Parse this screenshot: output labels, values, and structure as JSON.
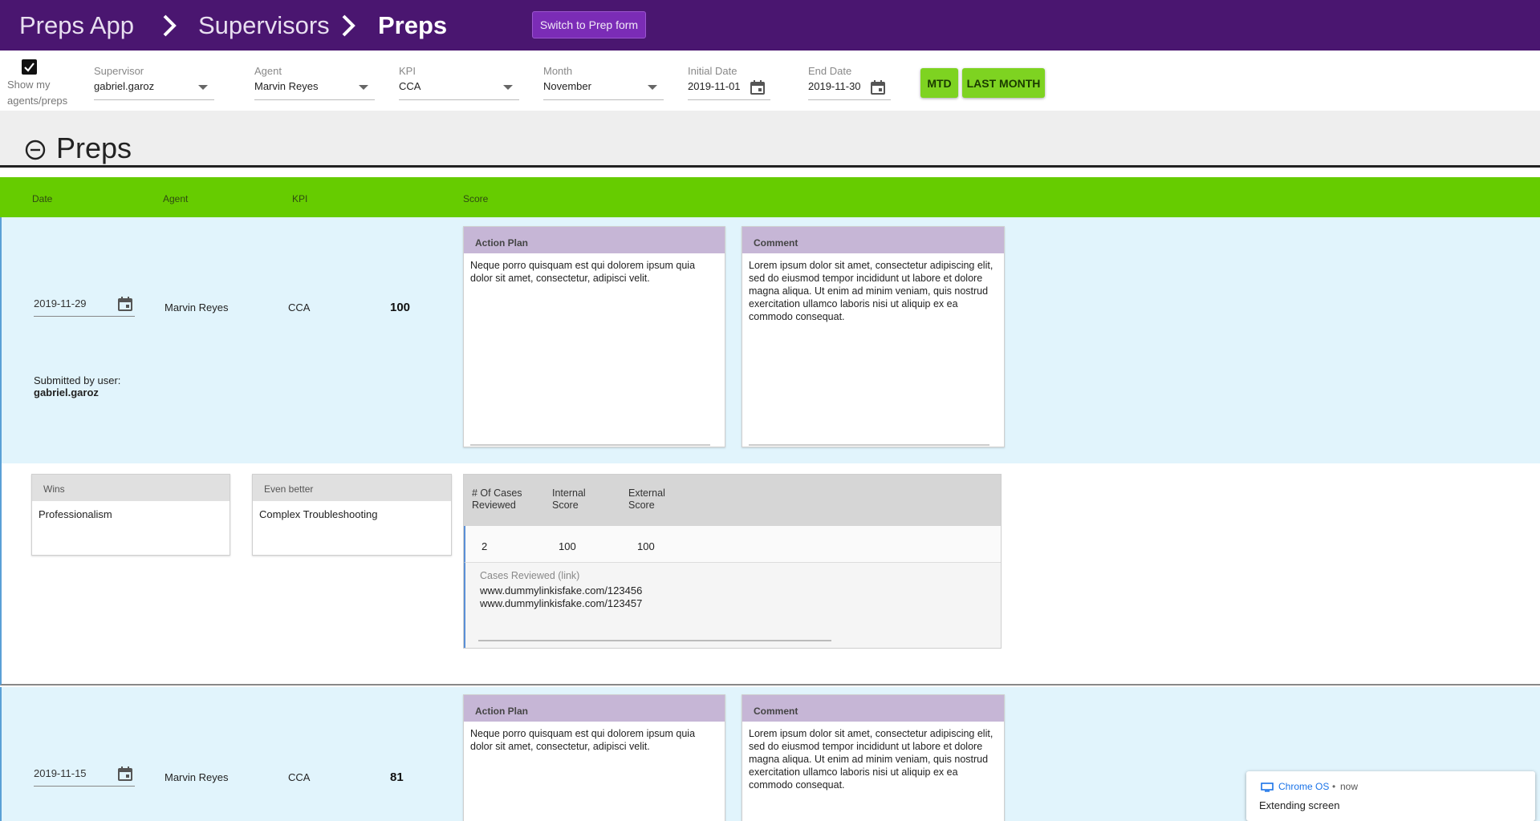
{
  "header": {
    "breadcrumbs": [
      "Preps App",
      "Supervisors",
      "Preps"
    ],
    "switch_button": "Switch to Prep form"
  },
  "filters": {
    "show_mine_label": "Show my agents/preps",
    "show_mine_checked": true,
    "supervisor": {
      "label": "Supervisor",
      "value": "gabriel.garoz"
    },
    "agent": {
      "label": "Agent",
      "value": "Marvin Reyes"
    },
    "kpi": {
      "label": "KPI",
      "value": "CCA"
    },
    "month": {
      "label": "Month",
      "value": "November"
    },
    "initial_date": {
      "label": "Initial Date",
      "value": "2019-11-01"
    },
    "end_date": {
      "label": "End Date",
      "value": "2019-11-30"
    },
    "mtd_button": "MTD",
    "last_month_button": "LAST MONTH"
  },
  "section": {
    "title": "Preps",
    "icon": "minus-circle-icon"
  },
  "table": {
    "headers": {
      "date": "Date",
      "agent": "Agent",
      "kpi": "KPI",
      "score": "Score"
    },
    "records": [
      {
        "date": "2019-11-29",
        "agent": "Marvin Reyes",
        "kpi": "CCA",
        "score": "100",
        "submitted_label": "Submitted by user:",
        "submitted_user": "gabriel.garoz",
        "action_plan_label": "Action Plan",
        "action_plan": "Neque porro quisquam est qui dolorem ipsum quia dolor sit amet, consectetur, adipisci velit.",
        "comment_label": "Comment",
        "comment": "Lorem ipsum dolor sit amet, consectetur adipiscing elit, sed do eiusmod tempor incididunt ut labore et dolore magna aliqua. Ut enim ad minim veniam, quis nostrud exercitation ullamco laboris nisi ut aliquip ex ea commodo consequat.",
        "wins_label": "Wins",
        "wins": "Professionalism",
        "even_better_label": "Even better",
        "even_better": "Complex Troubleshooting",
        "cases": {
          "headers": [
            "# Of Cases Reviewed",
            "Internal Score",
            "External Score"
          ],
          "values": [
            "2",
            "100",
            "100"
          ],
          "links_label": "Cases Reviewed (link)",
          "links": [
            "www.dummylinkisfake.com/123456",
            "www.dummylinkisfake.com/123457"
          ]
        }
      },
      {
        "date": "2019-11-15",
        "agent": "Marvin Reyes",
        "kpi": "CCA",
        "score": "81",
        "action_plan_label": "Action Plan",
        "action_plan": "Neque porro quisquam est qui dolorem ipsum quia dolor sit amet, consectetur, adipisci velit.",
        "comment_label": "Comment",
        "comment": "Lorem ipsum dolor sit amet, consectetur adipiscing elit, sed do eiusmod tempor incididunt ut labore et dolore magna aliqua. Ut enim ad minim veniam, quis nostrud exercitation ullamco laboris nisi ut aliquip ex ea commodo consequat."
      }
    ]
  },
  "notification": {
    "source": "Chrome OS",
    "time": "now",
    "message": "Extending screen"
  },
  "colors": {
    "header_bg": "#4a1670",
    "switch_btn": "#7b2cb6",
    "accent_green": "#66cc00",
    "button_green": "#7ed321",
    "record_bg": "#e1f4fc",
    "card_header": "#c6b6d6"
  }
}
